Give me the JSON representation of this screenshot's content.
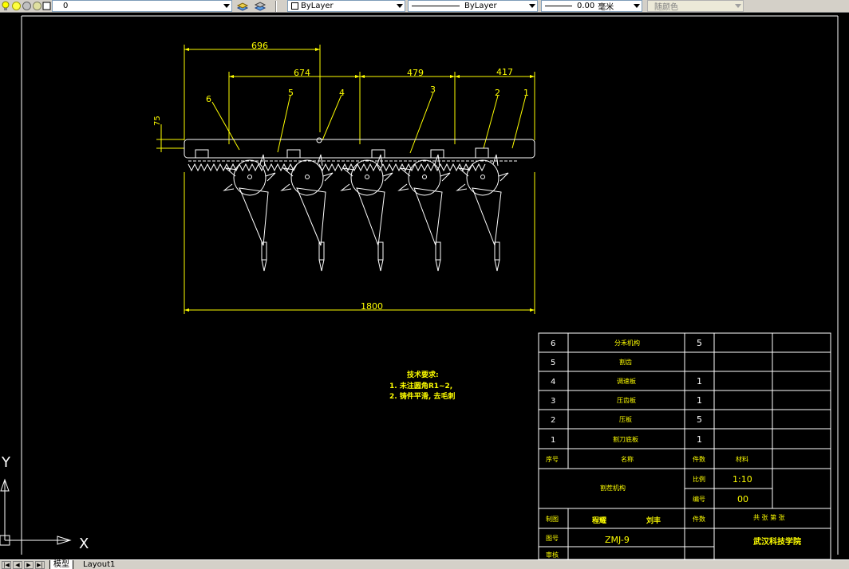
{
  "toolbar": {
    "layer_value": "0",
    "color_value": "ByLayer",
    "linetype_value": "ByLayer",
    "lineweight_value": "0.00",
    "lineweight_unit": "毫米",
    "plotstyle_value": "随颜色"
  },
  "drawing": {
    "dimensions": {
      "d696": "696",
      "d674": "674",
      "d479": "479",
      "d417": "417",
      "d75": "75",
      "d1800": "1800"
    },
    "balloons": [
      "6",
      "5",
      "4",
      "3",
      "2",
      "1"
    ],
    "tech_requirements": {
      "title": "技术要求:",
      "line1": "1. 未注圆角R1~2,",
      "line2": "2. 铸件平滑, 去毛刺"
    }
  },
  "title_block": {
    "parts": [
      {
        "no": "6",
        "name": "分禾机构",
        "qty": "5"
      },
      {
        "no": "5",
        "name": "割齿",
        "qty": ""
      },
      {
        "no": "4",
        "name": "调速板",
        "qty": "1"
      },
      {
        "no": "3",
        "name": "压齿板",
        "qty": "1"
      },
      {
        "no": "2",
        "name": "压板",
        "qty": "5"
      },
      {
        "no": "1",
        "name": "割刀底板",
        "qty": "1"
      }
    ],
    "header": {
      "no": "序号",
      "name": "名称",
      "qty": "件数",
      "material": "材料"
    },
    "assembly_name": "割茬机构",
    "scale_label": "比例",
    "scale_value": "1:10",
    "drawing_no_label": "编号",
    "drawing_no_value": "00",
    "drawer_label": "制图",
    "drawer_name": "程耀",
    "drawer_name2": "刘丰",
    "count_label": "件数",
    "approval": "共 张 第 张",
    "figure_label": "图号",
    "figure_value": "ZMJ-9",
    "check_label": "审核",
    "school": "武汉科技学院"
  },
  "ucs": {
    "x_label": "X",
    "y_label": "Y"
  },
  "tabs": {
    "model": "模型",
    "layout": "Layout1"
  }
}
